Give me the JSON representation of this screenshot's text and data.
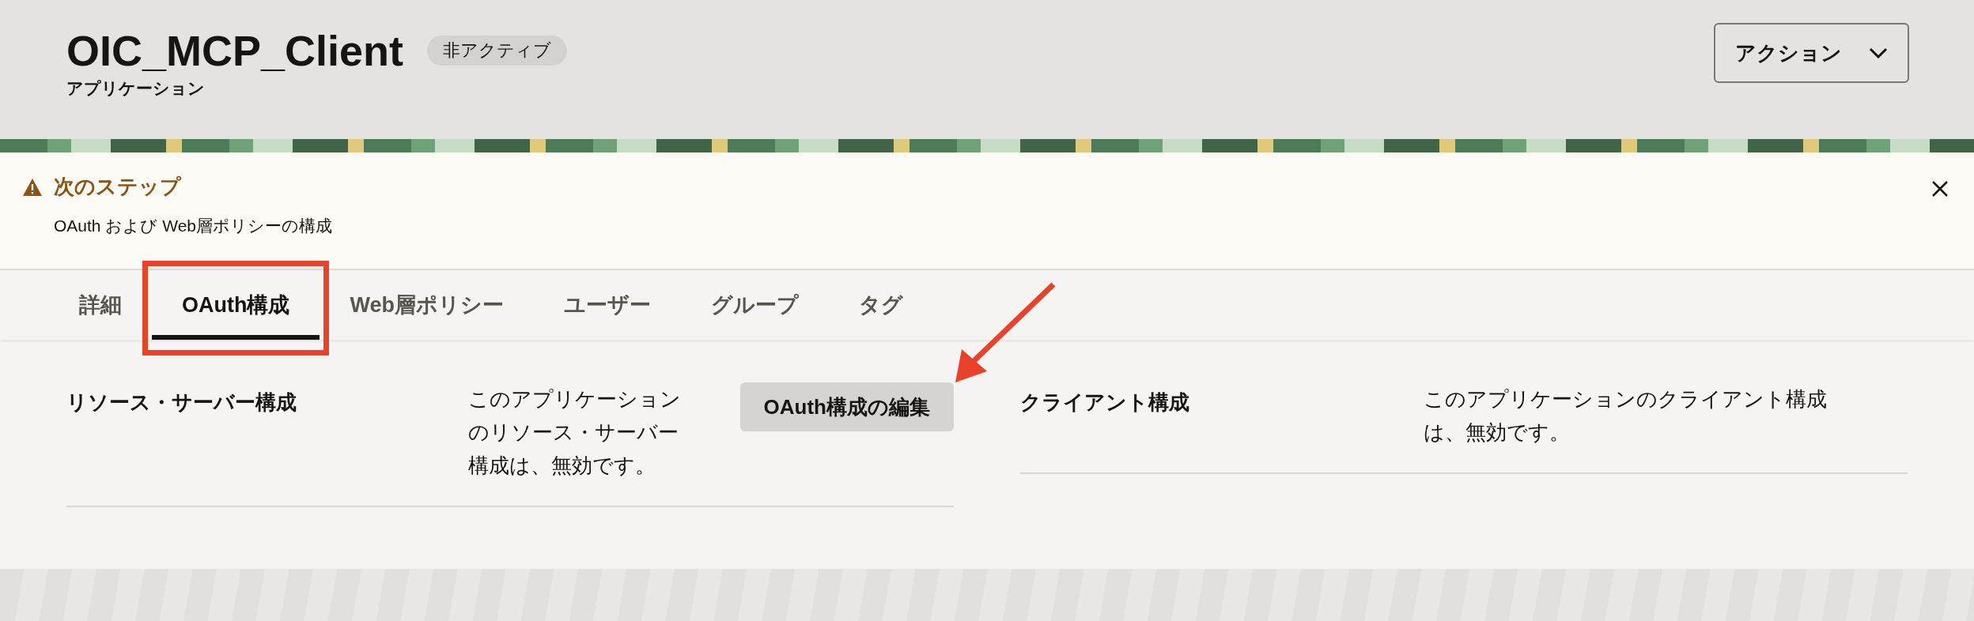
{
  "header": {
    "title": "OIC_MCP_Client",
    "status_badge": "非アクティブ",
    "subtitle": "アプリケーション",
    "actions_button": "アクション"
  },
  "notice": {
    "title": "次のステップ",
    "message": "OAuth および Web層ポリシーの構成"
  },
  "tabs": [
    {
      "label": "詳細",
      "selected": false,
      "highlighted": false
    },
    {
      "label": "OAuth構成",
      "selected": true,
      "highlighted": true
    },
    {
      "label": "Web層ポリシー",
      "selected": false,
      "highlighted": false
    },
    {
      "label": "ユーザー",
      "selected": false,
      "highlighted": false
    },
    {
      "label": "グループ",
      "selected": false,
      "highlighted": false
    },
    {
      "label": "タグ",
      "selected": false,
      "highlighted": false
    }
  ],
  "sections": [
    {
      "title": "リソース・サーバー構成",
      "description": "このアプリケーションのリソース・サーバー構成は、無効です。",
      "button": "OAuth構成の編集"
    },
    {
      "title": "クライアント構成",
      "description": "このアプリケーションのクライアント構成は、無効です。"
    }
  ]
}
